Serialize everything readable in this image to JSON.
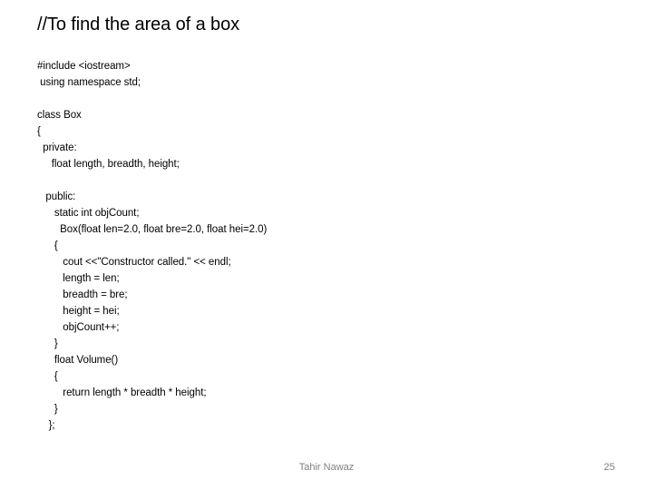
{
  "slide": {
    "title": "//To find the area of a box",
    "background_color": "#ffffff",
    "text_color": "#000000",
    "footer_color": "#808080"
  },
  "code_header": {
    "lines": [
      "#include <iostream>",
      " using namespace std;"
    ]
  },
  "code_body": {
    "lines": [
      "class Box",
      "{",
      "  private:",
      "     float length, breadth, height;",
      "",
      "   public:",
      "      static int objCount;",
      "        Box(float len=2.0, float bre=2.0, float hei=2.0)",
      "      {",
      "         cout <<\"Constructor called.\" << endl;",
      "         length = len;",
      "         breadth = bre;",
      "         height = hei;",
      "         objCount++;",
      "      }",
      "      float Volume()",
      "      {",
      "         return length * breadth * height;",
      "      }",
      "    };"
    ]
  },
  "footer": {
    "author": "Tahir Nawaz",
    "page_number": "25"
  }
}
